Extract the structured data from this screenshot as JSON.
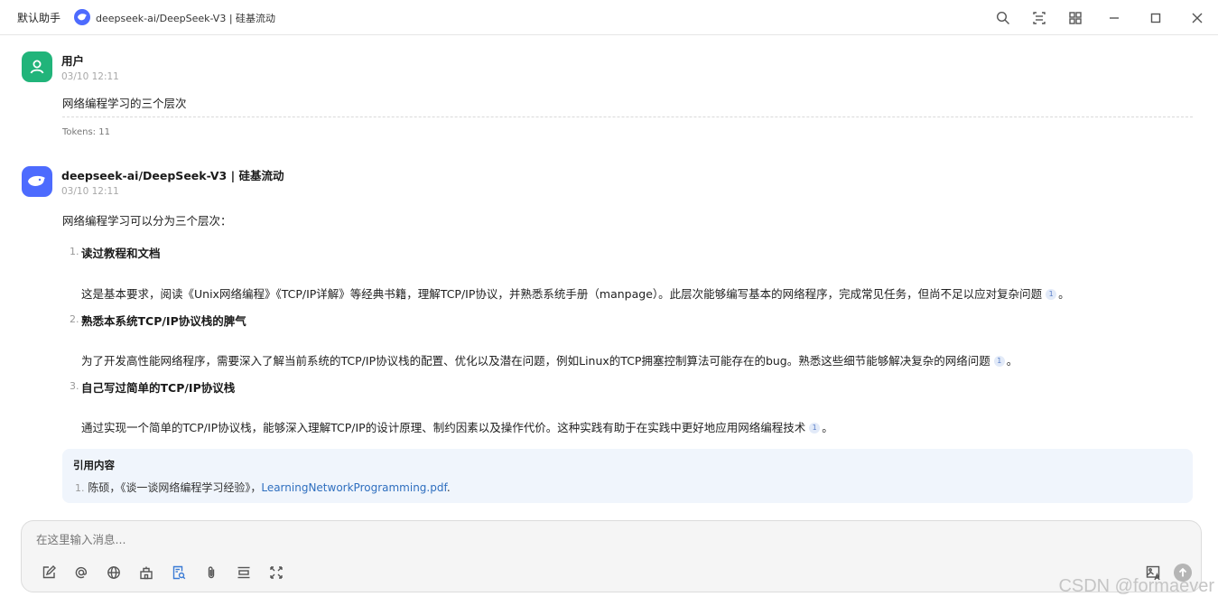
{
  "titlebar": {
    "assistant": "默认助手",
    "model": "deepseek-ai/DeepSeek-V3 | 硅基流动",
    "icons": [
      "search-icon",
      "layout-icon",
      "grid-icon",
      "minimize-icon",
      "maximize-icon",
      "close-icon"
    ]
  },
  "user_message": {
    "name": "用户",
    "time": "03/10 12:11",
    "text": "网络编程学习的三个层次",
    "tokens": "Tokens: 11"
  },
  "ai_message": {
    "name": "deepseek-ai/DeepSeek-V3 | 硅基流动",
    "time": "03/10 12:11",
    "intro": "网络编程学习可以分为三个层次：",
    "items": [
      {
        "num": "1.",
        "title": "读过教程和文档",
        "body": "这是基本要求，阅读《Unix网络编程》《TCP/IP详解》等经典书籍，理解TCP/IP协议，并熟悉系统手册（manpage）。此层次能够编写基本的网络程序，完成常见任务，但尚不足以应对复杂问题",
        "cite": "1",
        "end": "。"
      },
      {
        "num": "2.",
        "title": "熟悉本系统TCP/IP协议栈的脾气",
        "body": "为了开发高性能网络程序，需要深入了解当前系统的TCP/IP协议栈的配置、优化以及潜在问题，例如Linux的TCP拥塞控制算法可能存在的bug。熟悉这些细节能够解决复杂的网络问题",
        "cite": "1",
        "end": "。"
      },
      {
        "num": "3.",
        "title": "自己写过简单的TCP/IP协议栈",
        "body": "通过实现一个简单的TCP/IP协议栈，能够深入理解TCP/IP的设计原理、制约因素以及操作代价。这种实践有助于在实践中更好地应用网络编程技术",
        "cite": "1",
        "end": "。"
      }
    ],
    "references": {
      "title": "引用内容",
      "num": "1.",
      "text": "陈硕，《谈一谈网络编程学习经验》，",
      "link": "LearningNetworkProgramming.pdf",
      "end": "."
    }
  },
  "input": {
    "placeholder": "在这里输入消息...",
    "tools": [
      "edit-icon",
      "mention-icon",
      "globe-icon",
      "building-icon",
      "knowledge-search-icon",
      "attachment-icon",
      "divider-icon",
      "fullscreen-icon"
    ]
  },
  "watermark": "CSDN @formaever"
}
